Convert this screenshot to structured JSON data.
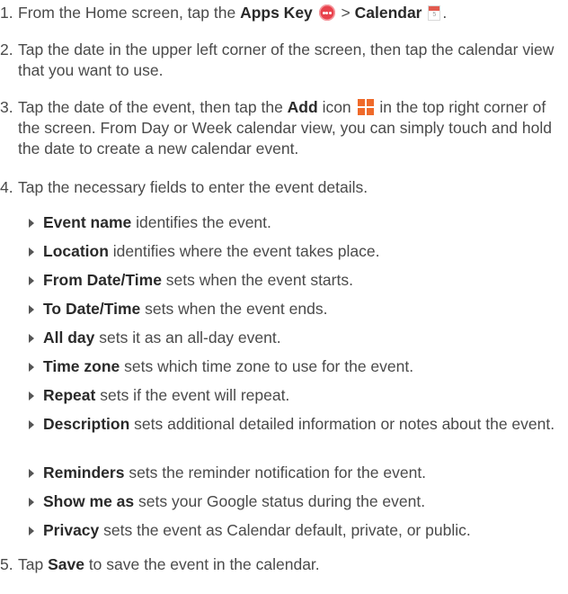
{
  "steps": [
    {
      "num": "1.",
      "parts": [
        "From the Home screen, tap the ",
        "Apps Key",
        " > ",
        "Calendar",
        "."
      ]
    },
    {
      "num": "2.",
      "text": "Tap the date in the upper left corner of the screen, then tap the calendar view that you want to use."
    },
    {
      "num": "3.",
      "parts": [
        "Tap the date of the event, then tap the ",
        "Add",
        " icon ",
        " in the top right corner of the screen. From Day or Week calendar view, you can simply touch and hold the date to create a new calendar event."
      ]
    },
    {
      "num": "4.",
      "text": "Tap the necessary fields to enter the event details."
    },
    {
      "num": "5.",
      "parts": [
        "Tap ",
        "Save",
        " to save the event in the calendar."
      ]
    }
  ],
  "icons": {
    "calendar_day": "5"
  },
  "fields": [
    {
      "term": "Event name",
      "desc": " identifies the event."
    },
    {
      "term": "Location",
      "desc": " identifies where the event takes place."
    },
    {
      "term": "From Date/Time",
      "desc": " sets when the event starts."
    },
    {
      "term": "To Date/Time",
      "desc": " sets when the event ends."
    },
    {
      "term": "All day",
      "desc": " sets it as an all-day event."
    },
    {
      "term": "Time zone",
      "desc": " sets which time zone to use for the event."
    },
    {
      "term": "Repeat",
      "desc": " sets if the event will repeat."
    },
    {
      "term": "Description",
      "desc": " sets additional detailed information or notes about the event."
    },
    {
      "term": "Reminders",
      "desc": " sets the reminder notification for the event."
    },
    {
      "term": "Show me as",
      "desc": " sets your Google status during the event."
    },
    {
      "term": "Privacy",
      "desc": " sets the event as Calendar default, private, or public."
    }
  ]
}
